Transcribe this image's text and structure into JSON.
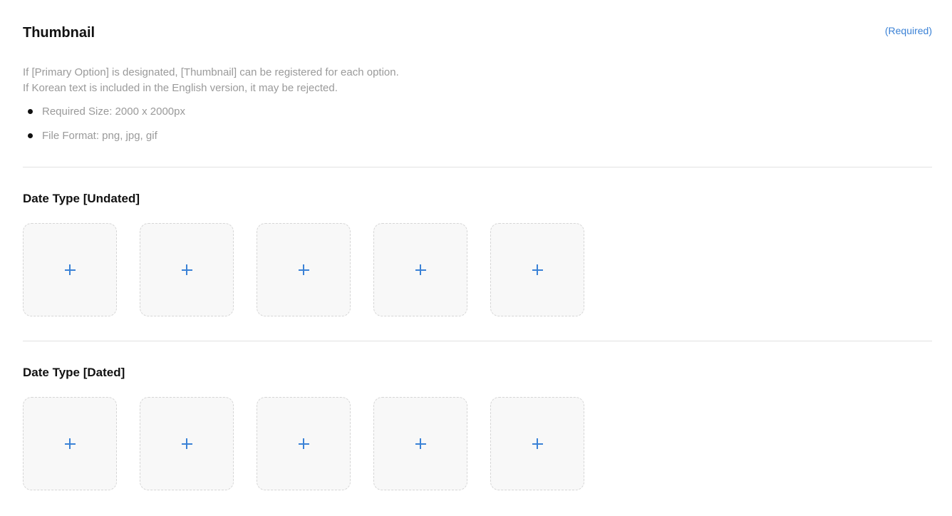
{
  "header": {
    "title": "Thumbnail",
    "required_label": "(Required)"
  },
  "description": {
    "lines": [
      "If [Primary Option] is designated, [Thumbnail] can be registered for each option.",
      "If Korean text is included in the English version, it may be rejected."
    ],
    "specs": [
      "Required Size: 2000 x 2000px",
      "File Format: png, jpg, gif"
    ]
  },
  "sections": [
    {
      "title": "Date Type [Undated]",
      "slot_icon": "plus-icon",
      "slot_count": 5
    },
    {
      "title": "Date Type [Dated]",
      "slot_icon": "plus-icon",
      "slot_count": 5
    }
  ],
  "colors": {
    "accent": "#3b82d6",
    "muted_text": "#9a9a9a",
    "slot_background": "#f8f8f8",
    "slot_border": "#d6d6d6",
    "divider": "#e2e2e2"
  }
}
